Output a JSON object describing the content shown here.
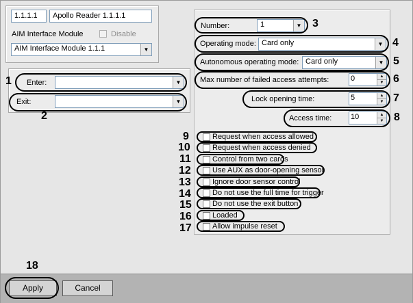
{
  "reader": {
    "id": "1.1.1.1",
    "name": "Apollo Reader 1.1.1.1",
    "module_label": "AIM Interface Module",
    "disable_label": "Disable",
    "module_value": "AIM Interface Module 1.1.1"
  },
  "left": {
    "enter_label": "Enter:",
    "enter_value": "",
    "exit_label": "Exit:",
    "exit_value": ""
  },
  "right": {
    "number_label": "Number:",
    "number_value": "1",
    "operating_mode_label": "Operating mode:",
    "operating_mode_value": "Card only",
    "autonomous_label": "Autonomous operating mode:",
    "autonomous_value": "Card only",
    "max_failed_label": "Max number of failed access attempts:",
    "max_failed_value": "0",
    "lock_time_label": "Lock opening time:",
    "lock_time_value": "5",
    "access_time_label": "Access time:",
    "access_time_value": "10"
  },
  "checkboxes": [
    {
      "label": "Request when access allowed",
      "checked": false
    },
    {
      "label": "Request when access denied",
      "checked": false
    },
    {
      "label": "Control from two cards",
      "checked": false
    },
    {
      "label": "Use AUX as door-opening sensor",
      "checked": false
    },
    {
      "label": "Ignore door sensor control",
      "checked": false
    },
    {
      "label": "Do not use the full time for trigger",
      "checked": false
    },
    {
      "label": "Do not use the exit button",
      "checked": false
    },
    {
      "label": "Loaded",
      "checked": false
    },
    {
      "label": "Allow impulse reset",
      "checked": false
    }
  ],
  "numbers": {
    "n1": "1",
    "n2": "2",
    "n3": "3",
    "n4": "4",
    "n5": "5",
    "n6": "6",
    "n7": "7",
    "n8": "8",
    "n9": "9",
    "n10": "10",
    "n11": "11",
    "n12": "12",
    "n13": "13",
    "n14": "14",
    "n15": "15",
    "n16": "16",
    "n17": "17",
    "n18": "18"
  },
  "footer": {
    "apply_label": "Apply",
    "cancel_label": "Cancel"
  }
}
